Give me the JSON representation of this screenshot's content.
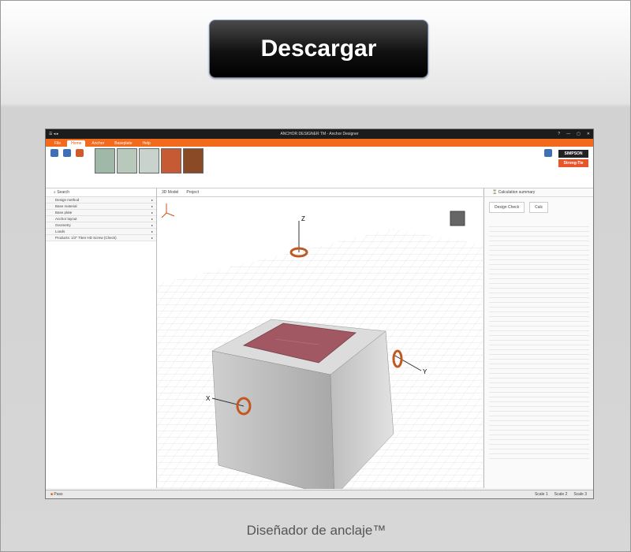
{
  "download_button": {
    "label": "Descargar"
  },
  "caption": "Diseñador de anclaje™",
  "app": {
    "window_title": "ANCHOR DESIGNER TM - Anchor Designer",
    "tabs": [
      "File",
      "Home",
      "Anchor",
      "Baseplate",
      "Help"
    ],
    "brand": {
      "top": "SIMPSON",
      "bottom": "Strong-Tie"
    },
    "left_panel": {
      "header": "Search",
      "items": [
        "Design method",
        "Base material",
        "Base plate",
        "Anchor layout",
        "Geometry",
        "Loads",
        "Products: 1/2\" Titen HD Screw (Check)"
      ]
    },
    "center_tabs": [
      "3D Model",
      "Project"
    ],
    "model_labels": [
      "Z",
      "X",
      "Y"
    ],
    "right_panel": {
      "header": "Calculation summary",
      "buttons": [
        "Design Check",
        "Calc"
      ]
    },
    "status": {
      "left": "Pass",
      "zooms": [
        "Scale 1",
        "Scale 2",
        "Scale 3"
      ]
    }
  },
  "colors": {
    "accent": "#f26a1b",
    "plate": "#9b4a55",
    "dark": "#111111"
  }
}
